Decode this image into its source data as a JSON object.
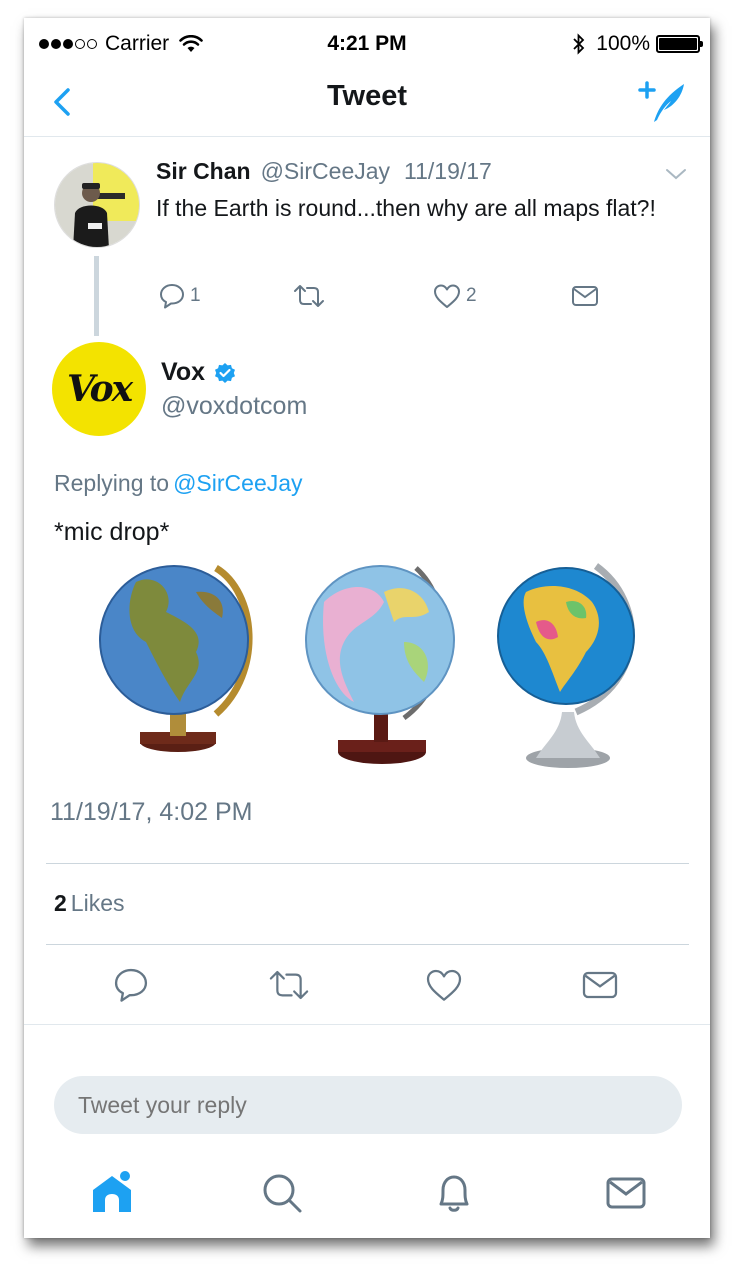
{
  "status_bar": {
    "carrier": "Carrier",
    "time": "4:21 PM",
    "battery": "100%"
  },
  "nav": {
    "title": "Tweet",
    "back_icon": "chevron-left-icon",
    "compose_icon": "compose-tweet-icon"
  },
  "parent_tweet": {
    "name": "Sir Chan",
    "handle": "@SirCeeJay",
    "date": "11/19/17",
    "text": "If the Earth is round...then why are all maps flat?!",
    "reply_count": "1",
    "like_count": "2"
  },
  "main_tweet": {
    "name": "Vox",
    "logo_text": "Vox",
    "handle": "@voxdotcom",
    "replying_label": "Replying to",
    "replying_to": "@SirCeeJay",
    "text": "*mic drop*",
    "timestamp": "11/19/17, 4:02 PM",
    "likes_count": "2",
    "likes_label": "Likes"
  },
  "reply": {
    "placeholder": "Tweet your reply"
  },
  "tabbar": {
    "items": [
      "home-icon",
      "search-icon",
      "notifications-icon",
      "messages-icon"
    ]
  },
  "colors": {
    "accent": "#1da1f2",
    "secondary_text": "#657786",
    "vox_yellow": "#f3e300"
  }
}
